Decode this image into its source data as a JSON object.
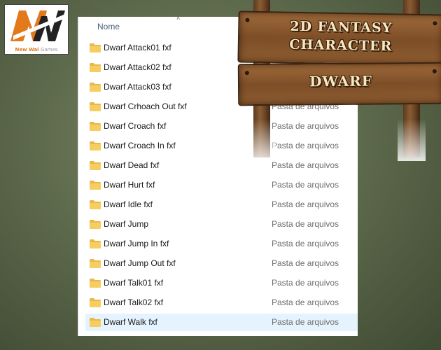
{
  "logo": {
    "part1": "New",
    "part2": "Wai",
    "part3": "Games",
    "colors": {
      "accent": "#e2791b",
      "dark": "#222222"
    }
  },
  "explorer": {
    "column_header": "Nome",
    "sort_indicator": "˄",
    "folder_icon": "folder-icon",
    "rows": [
      {
        "name": "Dwarf Attack01 fxf",
        "type": ""
      },
      {
        "name": "Dwarf Attack02 fxf",
        "type": ""
      },
      {
        "name": "Dwarf Attack03 fxf",
        "type": ""
      },
      {
        "name": "Dwarf Crhoach Out fxf",
        "type": "Pasta de arquivos"
      },
      {
        "name": "Dwarf Croach fxf",
        "type": "Pasta de arquivos"
      },
      {
        "name": "Dwarf Croach In fxf",
        "type": "Pasta de arquivos"
      },
      {
        "name": "Dwarf Dead fxf",
        "type": "Pasta de arquivos"
      },
      {
        "name": "Dwarf Hurt fxf",
        "type": "Pasta de arquivos"
      },
      {
        "name": "Dwarf Idle fxf",
        "type": "Pasta de arquivos"
      },
      {
        "name": "Dwarf Jump",
        "type": "Pasta de arquivos"
      },
      {
        "name": "Dwarf Jump In fxf",
        "type": "Pasta de arquivos"
      },
      {
        "name": "Dwarf Jump Out fxf",
        "type": "Pasta de arquivos"
      },
      {
        "name": "Dwarf Talk01 fxf",
        "type": "Pasta de arquivos"
      },
      {
        "name": "Dwarf Talk02 fxf",
        "type": "Pasta de arquivos"
      },
      {
        "name": "Dwarf Walk fxf",
        "type": "Pasta de arquivos",
        "selected": true
      }
    ]
  },
  "sign": {
    "line1": "2D FANTASY",
    "line2": "CHARACTER",
    "line3": "DWARF"
  }
}
